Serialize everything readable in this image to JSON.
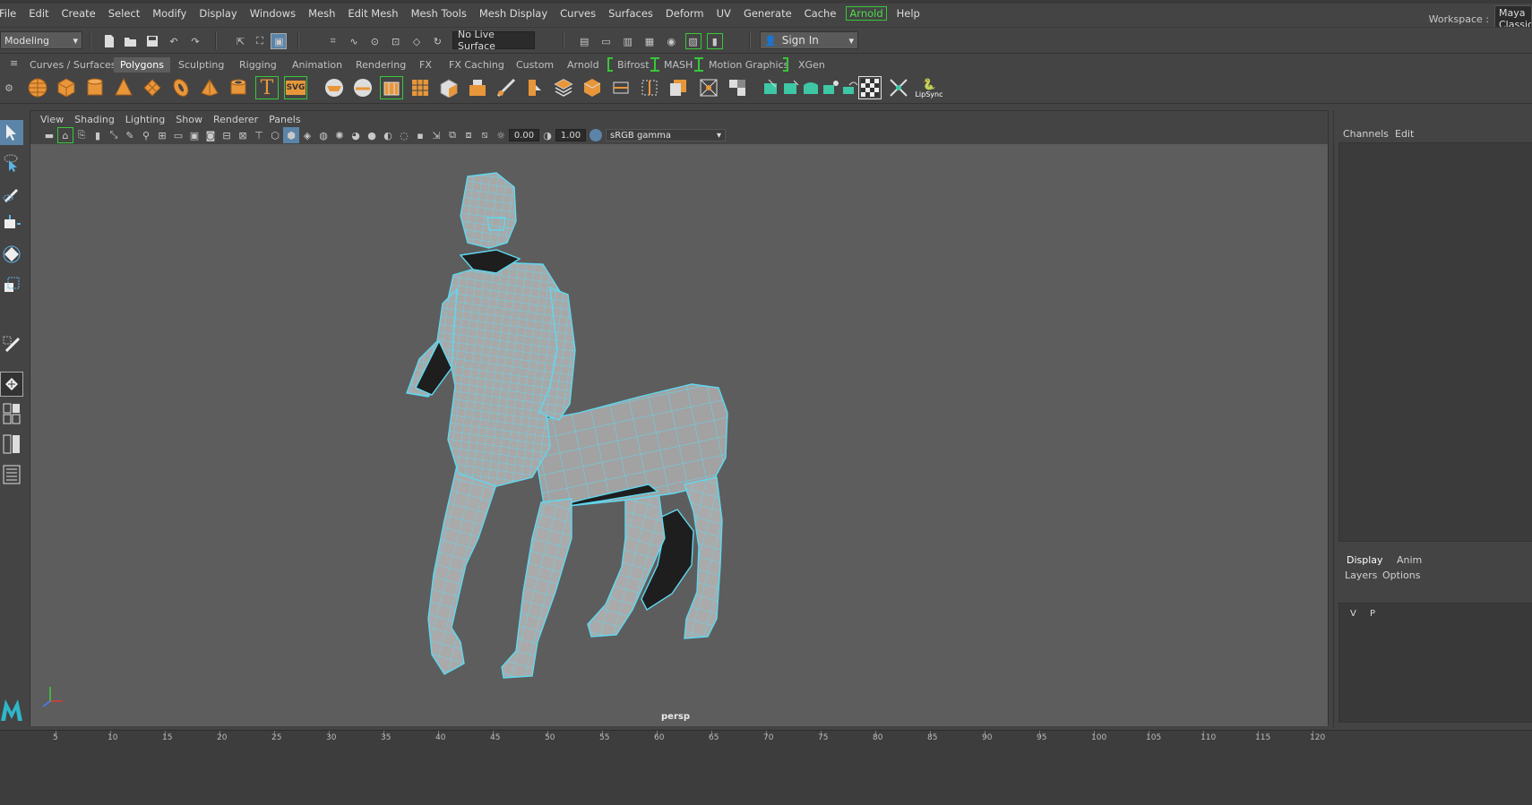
{
  "menubar": {
    "items": [
      "File",
      "Edit",
      "Create",
      "Select",
      "Modify",
      "Display",
      "Windows",
      "Mesh",
      "Edit Mesh",
      "Mesh Tools",
      "Mesh Display",
      "Curves",
      "Surfaces",
      "Deform",
      "UV",
      "Generate",
      "Cache",
      "Arnold",
      "Help"
    ],
    "workspace_label": "Workspace :",
    "workspace_value": "Maya Classic"
  },
  "statusline": {
    "mode": "Modeling",
    "live_surface": "No Live Surface",
    "sign_in": "Sign In"
  },
  "shelf_tabs": [
    "Curves / Surfaces",
    "Polygons",
    "Sculpting",
    "Rigging",
    "Animation",
    "Rendering",
    "FX",
    "FX Caching",
    "Custom",
    "Arnold",
    "Bifrost",
    "MASH",
    "Motion Graphics",
    "XGen"
  ],
  "shelf_active": "Polygons",
  "shelf": {
    "lipsync_label": "LipSync",
    "text_glyph": "T",
    "svg_glyph": "SVG"
  },
  "panel": {
    "menus": [
      "View",
      "Shading",
      "Lighting",
      "Show",
      "Renderer",
      "Panels"
    ],
    "exposure": "0.00",
    "gamma": "1.00",
    "color_space": "sRGB gamma",
    "camera_label": "persp"
  },
  "right_panel": {
    "tab_channels": "Channels",
    "tab_edit": "Edit",
    "tab_display": "Display",
    "tab_anim": "Anim",
    "layers": "Layers",
    "options": "Options",
    "v": "V",
    "p": "P"
  },
  "timeline": {
    "ticks": [
      5,
      10,
      15,
      20,
      25,
      30,
      35,
      40,
      45,
      50,
      55,
      60,
      65,
      70,
      75,
      80,
      85,
      90,
      95,
      100,
      105,
      110,
      115,
      120
    ]
  },
  "colors": {
    "wireframe": "#5fd8f0",
    "mesh": "#a9a9a9",
    "shelf_icon": "#e8963a",
    "arnold_green": "#37c837",
    "viewport_bg": "#5d5d5d"
  }
}
